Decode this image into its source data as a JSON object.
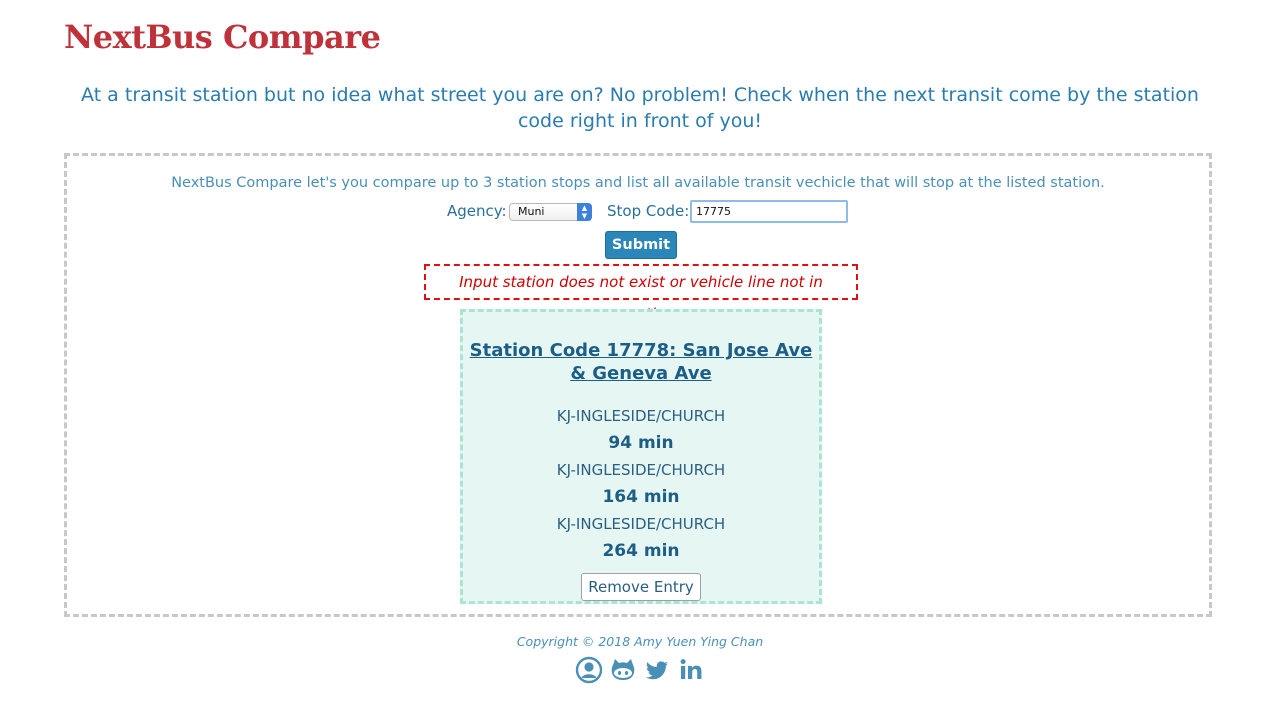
{
  "app": {
    "title": "NextBus Compare",
    "tagline": "At a transit station but no idea what street you are on? No problem! Check when the next transit come by the station code right in front of you!"
  },
  "form": {
    "intro": "NextBus Compare let's you compare up to 3 station stops and list all available transit vechicle that will stop at the listed station.",
    "agency_label": "Agency:",
    "agency_selected": "Muni",
    "stop_code_label": "Stop Code:",
    "stop_code_value": "17775",
    "submit_label": "Submit",
    "error_message": "Input station does not exist or vehicle line not in operation."
  },
  "stations": [
    {
      "title": "Station Code 17778: San Jose Ave & Geneva Ave",
      "arrivals": [
        {
          "route": "KJ-INGLESIDE/CHURCH",
          "time": "94 min"
        },
        {
          "route": "KJ-INGLESIDE/CHURCH",
          "time": "164 min"
        },
        {
          "route": "KJ-INGLESIDE/CHURCH",
          "time": "264 min"
        }
      ],
      "remove_label": "Remove Entry"
    }
  ],
  "footer": {
    "copyright": "Copyright © 2018 Amy Yuen Ying Chan",
    "social_icons": [
      "user-circle-icon",
      "github-icon",
      "twitter-icon",
      "linkedin-icon"
    ],
    "icon_color": "#4a90b6"
  },
  "colors": {
    "title": "#c0323a",
    "accent": "#2b86b9",
    "error": "#d00000",
    "card_background": "#e6f7f3"
  }
}
